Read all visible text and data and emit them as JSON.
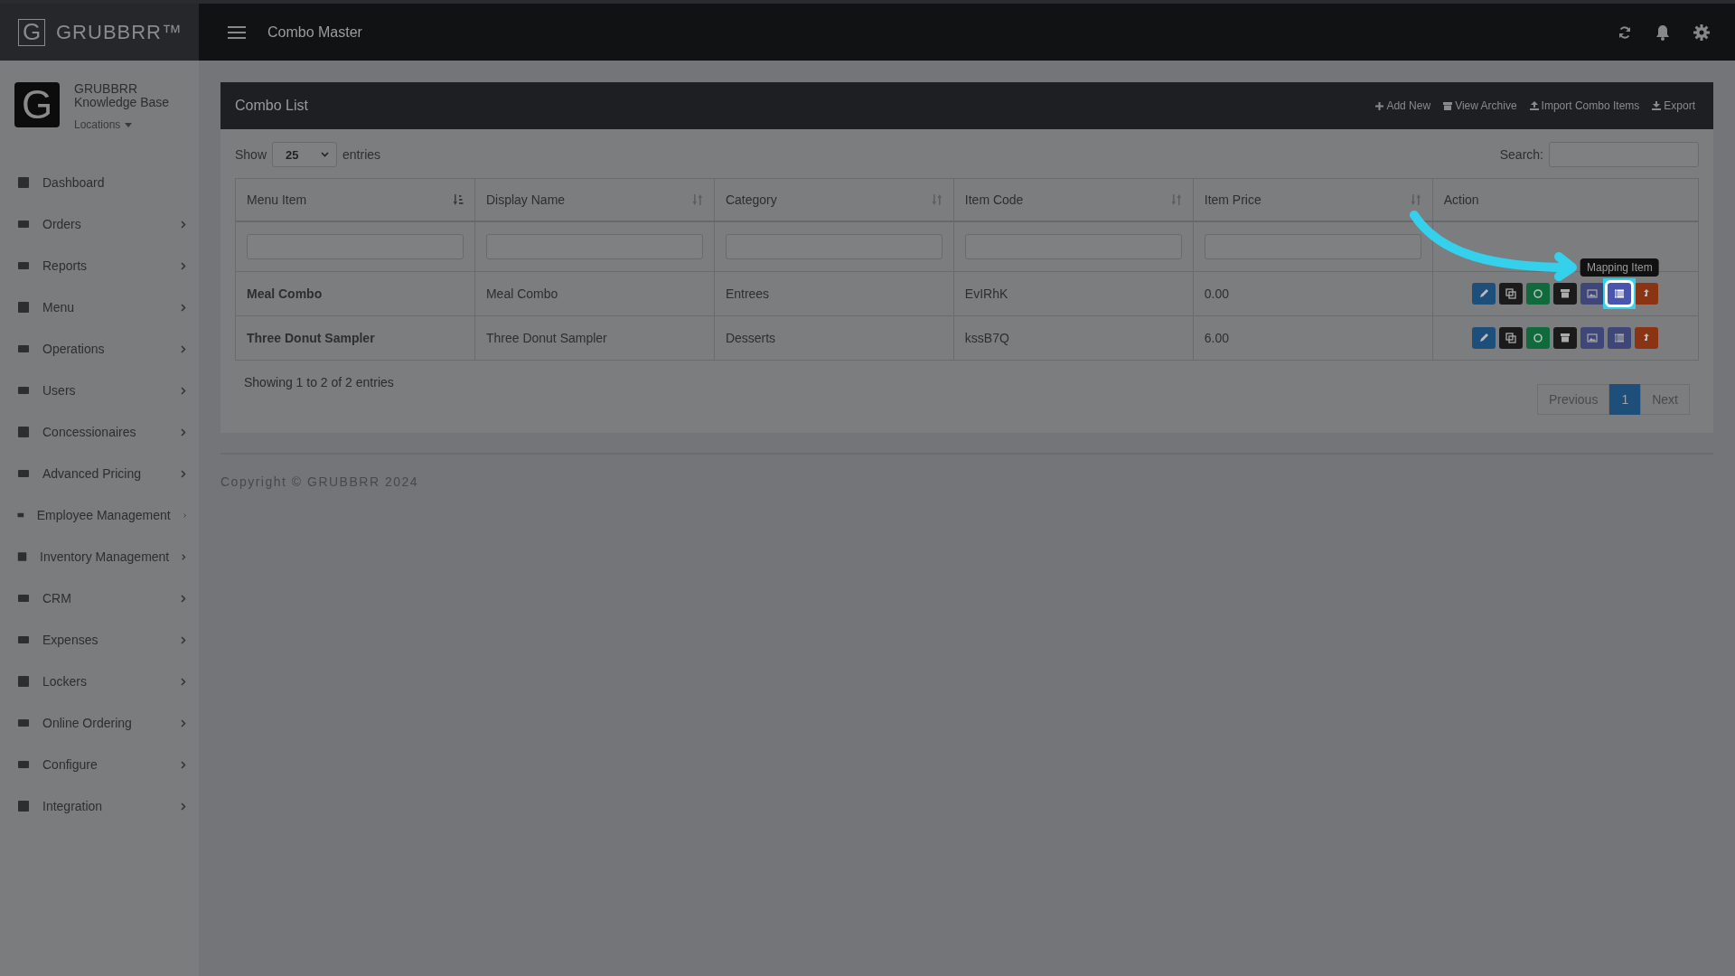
{
  "brand": {
    "name": "GRUBBRR™",
    "logo_letter": "G"
  },
  "topbar": {
    "title": "Combo Master"
  },
  "account": {
    "logo_letter": "G",
    "name": "GRUBBRR",
    "subtitle": "Knowledge Base",
    "locations": "Locations"
  },
  "sidebar": {
    "items": [
      {
        "label": "Dashboard",
        "submenu": false
      },
      {
        "label": "Orders",
        "submenu": true
      },
      {
        "label": "Reports",
        "submenu": true
      },
      {
        "label": "Menu",
        "submenu": true
      },
      {
        "label": "Operations",
        "submenu": true
      },
      {
        "label": "Users",
        "submenu": true
      },
      {
        "label": "Concessionaires",
        "submenu": true
      },
      {
        "label": "Advanced Pricing",
        "submenu": true
      },
      {
        "label": "Employee Management",
        "submenu": true
      },
      {
        "label": "Inventory Management",
        "submenu": true
      },
      {
        "label": "CRM",
        "submenu": true
      },
      {
        "label": "Expenses",
        "submenu": true
      },
      {
        "label": "Lockers",
        "submenu": true
      },
      {
        "label": "Online Ordering",
        "submenu": true
      },
      {
        "label": "Configure",
        "submenu": true
      },
      {
        "label": "Integration",
        "submenu": true
      }
    ]
  },
  "panel": {
    "title": "Combo List",
    "tools": [
      {
        "kind": "add",
        "label": "Add New"
      },
      {
        "kind": "archive",
        "label": "View Archive"
      },
      {
        "kind": "upload",
        "label": "Import Combo Items"
      },
      {
        "kind": "download",
        "label": "Export"
      }
    ]
  },
  "length": {
    "show": "Show",
    "value": "25",
    "entries": "entries"
  },
  "search": {
    "label": "Search:"
  },
  "table": {
    "columns": [
      {
        "label": "Menu Item",
        "kind": "sorted"
      },
      {
        "label": "Display Name",
        "kind": "sortable"
      },
      {
        "label": "Category",
        "kind": "sortable"
      },
      {
        "label": "Item Code",
        "kind": "sortable"
      },
      {
        "label": "Item Price",
        "kind": "sortable"
      },
      {
        "label": "Action",
        "kind": "plain"
      }
    ],
    "rows": [
      {
        "cells": [
          "Meal Combo",
          "Meal Combo",
          "Entrees",
          "EvIRhK",
          "0.00"
        ],
        "actions": [
          {
            "kind": "edit",
            "highlighted": false
          },
          {
            "kind": "copy",
            "highlighted": false
          },
          {
            "kind": "toggle",
            "highlighted": false
          },
          {
            "kind": "archive",
            "highlighted": false
          },
          {
            "kind": "image",
            "highlighted": false
          },
          {
            "kind": "list",
            "highlighted": true
          },
          {
            "kind": "upload",
            "highlighted": false
          }
        ]
      },
      {
        "cells": [
          "Three Donut Sampler",
          "Three Donut Sampler",
          "Desserts",
          "kssB7Q",
          "6.00"
        ],
        "actions": [
          {
            "kind": "edit",
            "highlighted": false
          },
          {
            "kind": "copy",
            "highlighted": false
          },
          {
            "kind": "toggle",
            "highlighted": false
          },
          {
            "kind": "archive",
            "highlighted": false
          },
          {
            "kind": "image",
            "highlighted": false
          },
          {
            "kind": "list",
            "highlighted": false
          },
          {
            "kind": "upload",
            "highlighted": false
          }
        ]
      }
    ]
  },
  "tooltip": {
    "text": "Mapping Item"
  },
  "info": "Showing 1 to 2 of 2 entries",
  "pagination": [
    {
      "label": "Previous",
      "selected": false
    },
    {
      "label": "1",
      "selected": true
    },
    {
      "label": "Next",
      "selected": false
    }
  ],
  "footer": "Copyright © GRUBBRR 2024"
}
